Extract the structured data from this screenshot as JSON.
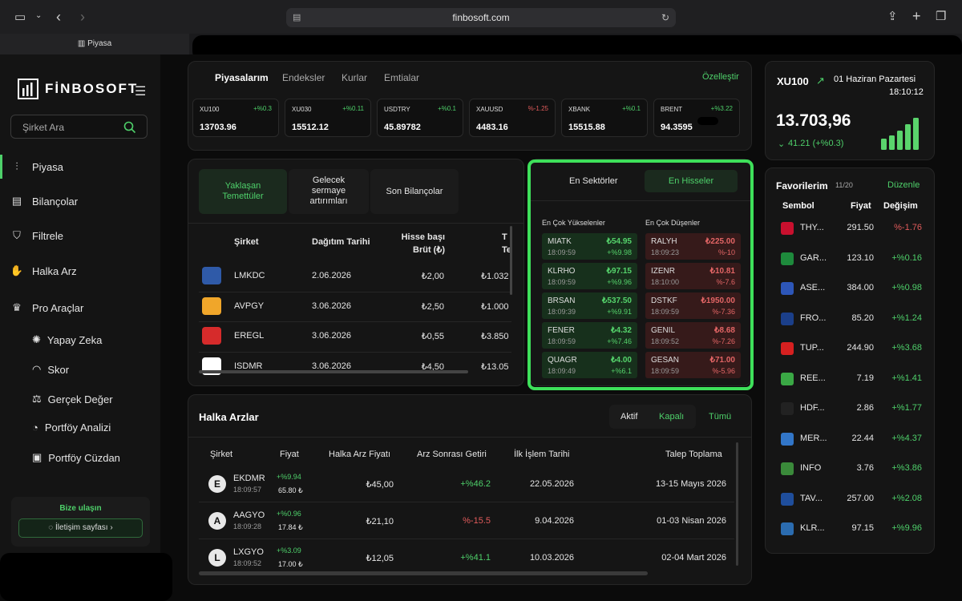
{
  "browser": {
    "url": "finbosoft.com",
    "tab_title": "Piyasa"
  },
  "sidebar": {
    "logo": "FİNBOSOFT",
    "search_placeholder": "Şirket Ara",
    "items": [
      {
        "label": "Piyasa",
        "icon": "candlestick-icon"
      },
      {
        "label": "Bilançolar",
        "icon": "document-icon"
      },
      {
        "label": "Filtrele",
        "icon": "filter-icon"
      },
      {
        "label": "Halka Arz",
        "icon": "handshake-icon"
      },
      {
        "label": "Pro Araçlar",
        "icon": "crown-icon"
      }
    ],
    "sub_items": [
      {
        "label": "Yapay Zeka",
        "icon": "brain-icon"
      },
      {
        "label": "Skor",
        "icon": "gauge-icon"
      },
      {
        "label": "Gerçek Değer",
        "icon": "scale-icon"
      },
      {
        "label": "Portföy Analizi",
        "icon": "pie-icon"
      },
      {
        "label": "Portföy Cüzdan",
        "icon": "wallet-icon"
      }
    ],
    "contact_title": "Bize ulaşın",
    "contact_button": "İletişim sayfası"
  },
  "markets": {
    "tabs": [
      "Piyasalarım",
      "Endeksler",
      "Kurlar",
      "Emtialar"
    ],
    "customize": "Özelleştir",
    "tickers": [
      {
        "name": "XU100",
        "change": "+%0.3",
        "value": "13703.96",
        "dir": "up"
      },
      {
        "name": "XU030",
        "change": "+%0.11",
        "value": "15512.12",
        "dir": "up"
      },
      {
        "name": "USDTRY",
        "change": "+%0.1",
        "value": "45.89782",
        "dir": "up"
      },
      {
        "name": "XAUUSD",
        "change": "%-1.25",
        "value": "4483.16",
        "dir": "down"
      },
      {
        "name": "XBANK",
        "change": "+%0.1",
        "value": "15515.88",
        "dir": "up"
      },
      {
        "name": "BRENT",
        "change": "+%3.22",
        "value": "94.3595",
        "dir": "up"
      }
    ]
  },
  "index_card": {
    "name": "XU100",
    "date": "01 Haziran Pazartesi",
    "time": "18:10:12",
    "value": "13.703,96",
    "change": "41.21 (+%0.3)"
  },
  "dividends": {
    "tabs": [
      "Yaklaşan Temettüler",
      "Gelecek sermaye artırımları",
      "Son Bilançolar"
    ],
    "headers": [
      "Şirket",
      "Dağıtım Tarihi",
      "Hisse başı Brüt (₺)",
      "T Te"
    ],
    "rows": [
      {
        "name": "LMKDC",
        "date": "2.06.2026",
        "per": "₺2,00",
        "total": "₺1.032",
        "logo_color": "#2f5aa8"
      },
      {
        "name": "AVPGY",
        "date": "3.06.2026",
        "per": "₺2,50",
        "total": "₺1.000",
        "logo_color": "#f0a62a"
      },
      {
        "name": "EREGL",
        "date": "3.06.2026",
        "per": "₺0,55",
        "total": "₺3.850",
        "logo_color": "#d62b2b"
      },
      {
        "name": "ISDMR",
        "date": "3.06.2026",
        "per": "₺4,50",
        "total": "₺13.05",
        "logo_color": "#ffffff"
      }
    ]
  },
  "movers": {
    "tabs": [
      "En Sektörler",
      "En Hisseler"
    ],
    "gainers_title": "En Çok Yükselenler",
    "losers_title": "En Çok Düşenler",
    "gainers": [
      {
        "name": "MIATK",
        "time": "18:09:59",
        "price": "₺54.95",
        "change": "+%9.98"
      },
      {
        "name": "KLRHO",
        "time": "18:09:59",
        "price": "₺97.15",
        "change": "+%9.96"
      },
      {
        "name": "BRSAN",
        "time": "18:09:39",
        "price": "₺537.50",
        "change": "+%9.91"
      },
      {
        "name": "FENER",
        "time": "18:09:59",
        "price": "₺4.32",
        "change": "+%7.46"
      },
      {
        "name": "QUAGR",
        "time": "18:09:49",
        "price": "₺4.00",
        "change": "+%6.1"
      }
    ],
    "losers": [
      {
        "name": "RALYH",
        "time": "18:09:23",
        "price": "₺225.00",
        "change": "%-10"
      },
      {
        "name": "IZENR",
        "time": "18:10:00",
        "price": "₺10.81",
        "change": "%-7.6"
      },
      {
        "name": "DSTKF",
        "time": "18:09:59",
        "price": "₺1950.00",
        "change": "%-7.36"
      },
      {
        "name": "GENIL",
        "time": "18:09:52",
        "price": "₺8.68",
        "change": "%-7.26"
      },
      {
        "name": "GESAN",
        "time": "18:09:59",
        "price": "₺71.00",
        "change": "%-5.96"
      }
    ]
  },
  "favorites": {
    "title": "Favorilerim",
    "count": "11/20",
    "edit": "Düzenle",
    "headers": [
      "Sembol",
      "Fiyat",
      "Değişim"
    ],
    "rows": [
      {
        "name": "THY...",
        "price": "291.50",
        "change": "%-1.76",
        "dir": "down",
        "logo_color": "#c8102e"
      },
      {
        "name": "GAR...",
        "price": "123.10",
        "change": "+%0.16",
        "dir": "up",
        "logo_color": "#1e8a3c"
      },
      {
        "name": "ASE...",
        "price": "384.00",
        "change": "+%0.98",
        "dir": "up",
        "logo_color": "#2d56b8"
      },
      {
        "name": "FRO...",
        "price": "85.20",
        "change": "+%1.24",
        "dir": "up",
        "logo_color": "#1b3f8a"
      },
      {
        "name": "TUP...",
        "price": "244.90",
        "change": "+%3.68",
        "dir": "up",
        "logo_color": "#d62020"
      },
      {
        "name": "REE...",
        "price": "7.19",
        "change": "+%1.41",
        "dir": "up",
        "logo_color": "#3aa845"
      },
      {
        "name": "HDF...",
        "price": "2.86",
        "change": "+%1.77",
        "dir": "up",
        "logo_color": "#222222"
      },
      {
        "name": "MER...",
        "price": "22.44",
        "change": "+%4.37",
        "dir": "up",
        "logo_color": "#3276c8"
      },
      {
        "name": "INFO",
        "price": "3.76",
        "change": "+%3.86",
        "dir": "up",
        "logo_color": "#3a8a3a"
      },
      {
        "name": "TAV...",
        "price": "257.00",
        "change": "+%2.08",
        "dir": "up",
        "logo_color": "#1f4e9c"
      },
      {
        "name": "KLR...",
        "price": "97.15",
        "change": "+%9.96",
        "dir": "up",
        "logo_color": "#2b6cb0"
      }
    ]
  },
  "ipo": {
    "title": "Halka Arzlar",
    "filters": [
      "Aktif",
      "Kapalı",
      "Tümü"
    ],
    "headers": [
      "Şirket",
      "Fiyat",
      "Halka Arz Fiyatı",
      "Arz Sonrası Getiri",
      "İlk İşlem Tarihi",
      "Talep Toplama"
    ],
    "rows": [
      {
        "letter": "E",
        "name": "EKDMR",
        "time": "18:09:57",
        "change": "+%9.94",
        "price": "65.80 ₺",
        "ipo_price": "₺45,00",
        "return": "+%46.2",
        "return_dir": "up",
        "first_date": "22.05.2026",
        "demand": "13-15 Mayıs 2026"
      },
      {
        "letter": "A",
        "name": "AAGYO",
        "time": "18:09:28",
        "change": "+%0.96",
        "price": "17.84 ₺",
        "ipo_price": "₺21,10",
        "return": "%-15.5",
        "return_dir": "down",
        "first_date": "9.04.2026",
        "demand": "01-03 Nisan 2026"
      },
      {
        "letter": "L",
        "name": "LXGYO",
        "time": "18:09:52",
        "change": "+%3.09",
        "price": "17.00 ₺",
        "ipo_price": "₺12,05",
        "return": "+%41.1",
        "return_dir": "up",
        "first_date": "10.03.2026",
        "demand": "02-04 Mart 2026"
      }
    ]
  },
  "colors": {
    "accent": "#4ed06a",
    "down": "#e15b5b",
    "highlight": "#3ee05a"
  }
}
